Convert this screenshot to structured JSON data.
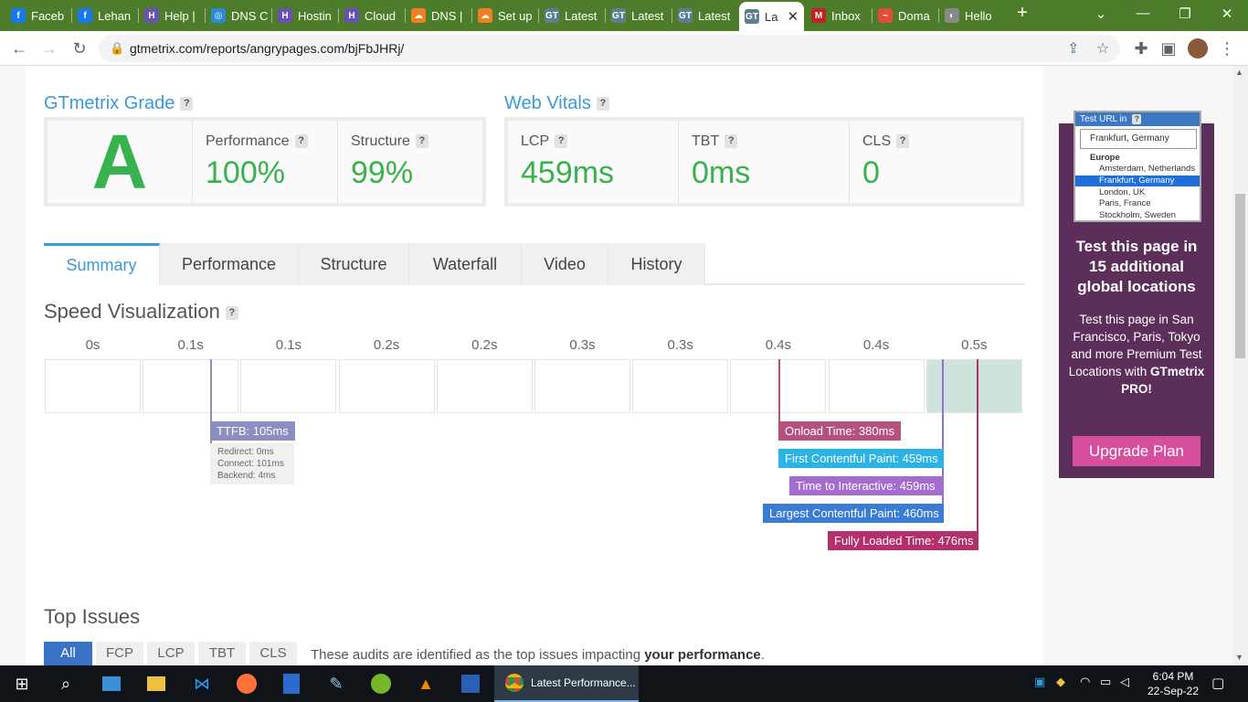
{
  "tabs": [
    {
      "label": "Faceb",
      "favicon": "f",
      "favicon_color": "#1877f2"
    },
    {
      "label": "Lehan",
      "favicon": "f",
      "favicon_color": "#1877f2"
    },
    {
      "label": "Help |",
      "favicon": "H",
      "favicon_color": "#6a4fb5"
    },
    {
      "label": "DNS C",
      "favicon": "◎",
      "favicon_color": "#2a8bd8"
    },
    {
      "label": "Hostin",
      "favicon": "H",
      "favicon_color": "#6a4fb5"
    },
    {
      "label": "Cloud",
      "favicon": "H",
      "favicon_color": "#6a4fb5"
    },
    {
      "label": "DNS |",
      "favicon": "☁",
      "favicon_color": "#f38020"
    },
    {
      "label": "Set up",
      "favicon": "☁",
      "favicon_color": "#f38020"
    },
    {
      "label": "Latest",
      "favicon": "GT",
      "favicon_color": "#5b7f8e"
    },
    {
      "label": "Latest",
      "favicon": "GT",
      "favicon_color": "#5b7f8e"
    },
    {
      "label": "Latest",
      "favicon": "GT",
      "favicon_color": "#5b7f8e"
    },
    {
      "label": "La",
      "favicon": "GT",
      "favicon_color": "#5b7f8e",
      "active": true
    },
    {
      "label": "Inbox",
      "favicon": "M",
      "favicon_color": "#c5221f"
    },
    {
      "label": "Doma",
      "favicon": "~",
      "favicon_color": "#e04e39"
    },
    {
      "label": "Hello",
      "favicon": "◐",
      "favicon_color": "#888888"
    }
  ],
  "browser": {
    "url": "gtmetrix.com/reports/angrypages.com/bjFbJHRj/",
    "new_tab": "+",
    "tab_close": "✕"
  },
  "grade": {
    "title": "GTmetrix Grade",
    "letter": "A",
    "performance_label": "Performance",
    "performance_value": "100%",
    "structure_label": "Structure",
    "structure_value": "99%"
  },
  "vitals": {
    "title": "Web Vitals",
    "lcp_label": "LCP",
    "lcp_value": "459ms",
    "tbt_label": "TBT",
    "tbt_value": "0ms",
    "cls_label": "CLS",
    "cls_value": "0"
  },
  "help_glyph": "?",
  "page_tabs": [
    "Summary",
    "Performance",
    "Structure",
    "Waterfall",
    "Video",
    "History"
  ],
  "speed": {
    "title": "Speed Visualization",
    "ticks": [
      "0s",
      "0.1s",
      "0.1s",
      "0.2s",
      "0.2s",
      "0.3s",
      "0.3s",
      "0.4s",
      "0.4s",
      "0.5s"
    ],
    "ttfb": "TTFB: 105ms",
    "ttfb_details": [
      "Redirect: 0ms",
      "Connect: 101ms",
      "Backend: 4ms"
    ],
    "onload": "Onload Time: 380ms",
    "fcp": "First Contentful Paint: 459ms",
    "tti": "Time to Interactive: 459ms",
    "lcp": "Largest Contentful Paint: 460ms",
    "fully_loaded": "Fully Loaded Time: 476ms",
    "colors": {
      "ttfb": "#8a8fc0",
      "onload": "#b3527c",
      "fcp": "#2bb3e6",
      "tti": "#a56ccf",
      "lcp": "#3a7bd5",
      "fully_loaded": "#b3306d"
    }
  },
  "issues": {
    "title": "Top Issues",
    "tabs": [
      "All",
      "FCP",
      "LCP",
      "TBT",
      "CLS"
    ],
    "desc_prefix": "These audits are identified as the top issues impacting ",
    "desc_bold": "your performance",
    "desc_suffix": "."
  },
  "ad": {
    "widget_title": "Test URL in",
    "widget_selected": "Frankfurt, Germany",
    "widget_group": "Europe",
    "widget_options": [
      "Amsterdam, Netherlands",
      "Frankfurt, Germany",
      "London, UK",
      "Paris, France",
      "Stockholm, Sweden"
    ],
    "title_lines": [
      "Test this page in",
      "15 additional",
      "global locations"
    ],
    "body_text": "Test this page in San Francisco, Paris, Tokyo and more Premium Test Locations with",
    "body_bold": "GTmetrix PRO!",
    "button": "Upgrade Plan"
  },
  "taskbar": {
    "active_app": "Latest Performance...",
    "time": "6:04 PM",
    "date": "22-Sep-22"
  }
}
